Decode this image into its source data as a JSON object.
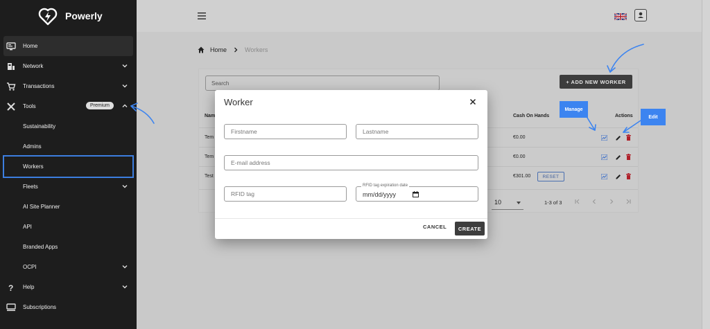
{
  "brand": {
    "name": "Powerly"
  },
  "sidebar": {
    "items": [
      {
        "label": "Home",
        "icon": "dashboard-icon"
      },
      {
        "label": "Network",
        "icon": "network-icon"
      },
      {
        "label": "Transactions",
        "icon": "cart-icon"
      },
      {
        "label": "Tools",
        "icon": "tools-icon",
        "badge": "Premium"
      },
      {
        "label": "Sustainability"
      },
      {
        "label": "Admins"
      },
      {
        "label": "Workers"
      },
      {
        "label": "Fleets"
      },
      {
        "label": "AI Site Planner"
      },
      {
        "label": "API"
      },
      {
        "label": "Branded Apps"
      },
      {
        "label": "OCPI"
      },
      {
        "label": "Help",
        "icon": "help-icon"
      },
      {
        "label": "Subscriptions",
        "icon": "subscriptions-icon"
      }
    ]
  },
  "breadcrumb": {
    "home": "Home",
    "current": "Workers"
  },
  "toolbar": {
    "search_placeholder": "Search",
    "add_label": "+ ADD NEW WORKER"
  },
  "table": {
    "headers": {
      "name": "Nam",
      "cash": "Cash On Hands",
      "actions": "Actions"
    },
    "rows": [
      {
        "name": "Tem",
        "cash": "€0.00"
      },
      {
        "name": "Tem",
        "cash": "€0.00"
      },
      {
        "name": "Test",
        "cash": "€301.00",
        "reset": "RESET"
      }
    ],
    "rows_per_page": "10",
    "range": "1-3 of 3"
  },
  "tooltips": {
    "manage": "Manage",
    "edit": "Edit"
  },
  "modal": {
    "title": "Worker",
    "firstname_placeholder": "Firstname",
    "lastname_placeholder": "Lastname",
    "email_placeholder": "E-mail address",
    "rfid_placeholder": "RFID tag",
    "rfid_expiration_label": "RFID tag expiration date",
    "rfid_expiration_value": "mm/dd/yyyy",
    "cancel_label": "CANCEL",
    "create_label": "CREATE"
  },
  "colors": {
    "accent": "#3c84f0",
    "sidebar_bg": "#1d1d1d",
    "button_dark": "#3d3d3d",
    "delete_red": "#b0202a"
  }
}
